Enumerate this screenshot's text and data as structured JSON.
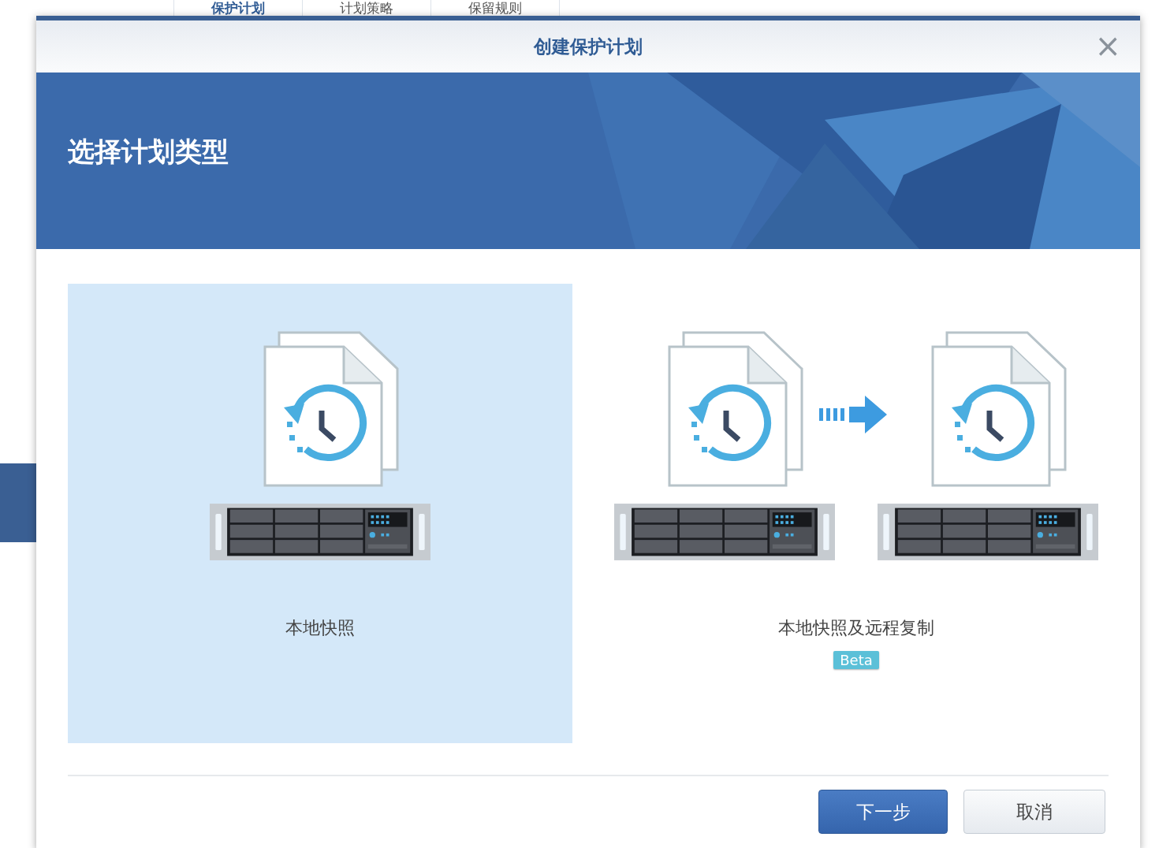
{
  "background_tabs": [
    {
      "label": "保护计划",
      "selected": true
    },
    {
      "label": "计划策略",
      "selected": false
    },
    {
      "label": "保留规则",
      "selected": false
    }
  ],
  "dialog": {
    "title": "创建保护计划",
    "close": "×",
    "heading": "选择计划类型",
    "options": [
      {
        "kind": "local",
        "label": "本地快照",
        "selected": true
      },
      {
        "kind": "remote",
        "label": "本地快照及远程复制",
        "badge": "Beta",
        "selected": false
      }
    ],
    "buttons": [
      {
        "label": "下一步",
        "kind": "primary"
      },
      {
        "label": "取消",
        "kind": "secondary"
      }
    ]
  }
}
